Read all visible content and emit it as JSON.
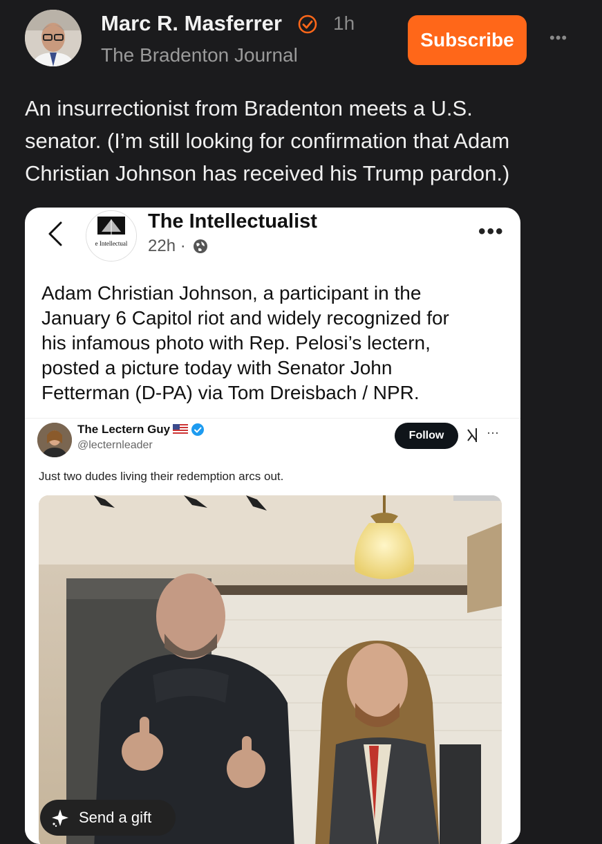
{
  "header": {
    "author_name": "Marc R. Masferrer",
    "time_ago": "1h",
    "publication": "The Bradenton Journal",
    "subscribe_label": "Subscribe",
    "more_label": "•••"
  },
  "post": {
    "lines": [
      "An insurrectionist from Bradenton meets a U.S.",
      "senator. (I’m still looking for confirmation that Adam",
      "Christian Johnson has received his Trump pardon.)"
    ]
  },
  "embed": {
    "account_name": "The Intellectualist",
    "avatar_text": "e Intellectual",
    "time": "22h ·",
    "more_label": "•••",
    "lines": [
      "Adam Christian Johnson, a participant in the",
      "January 6 Capitol riot and widely recognized for",
      "his infamous photo with Rep. Pelosi’s lectern,",
      "posted a picture today with Senator John",
      "Fetterman (D-PA) via Tom Dreisbach / NPR."
    ]
  },
  "tweet": {
    "name": "The Lectern Guy",
    "handle": "@lecternleader",
    "follow_label": "Follow",
    "more_label": "···",
    "text": "Just two dudes living their redemption arcs out."
  },
  "gift": {
    "label": "Send a gift"
  },
  "colors": {
    "background": "#1b1b1d",
    "accent": "#ff6719",
    "embed_bg": "#ffffff"
  }
}
